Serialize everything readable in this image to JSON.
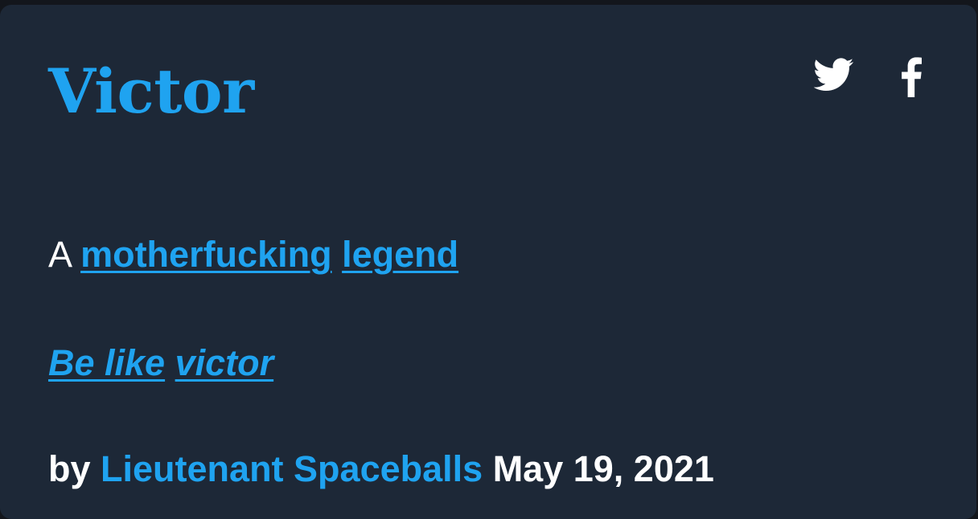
{
  "entry": {
    "word": "Victor",
    "meaning": {
      "prefix": "A",
      "links": [
        "motherfucking",
        "legend"
      ]
    },
    "example": {
      "links": [
        "Be like",
        "victor"
      ]
    },
    "contributor": {
      "by_label": "by",
      "author": "Lieutenant Spaceballs",
      "date": "May 19, 2021"
    }
  },
  "share": {
    "icons": [
      "twitter-icon",
      "facebook-icon"
    ]
  },
  "colors": {
    "accent": "#1fa3f0",
    "card_background": "#1d2837",
    "page_background": "#13161c",
    "text": "#ffffff"
  }
}
